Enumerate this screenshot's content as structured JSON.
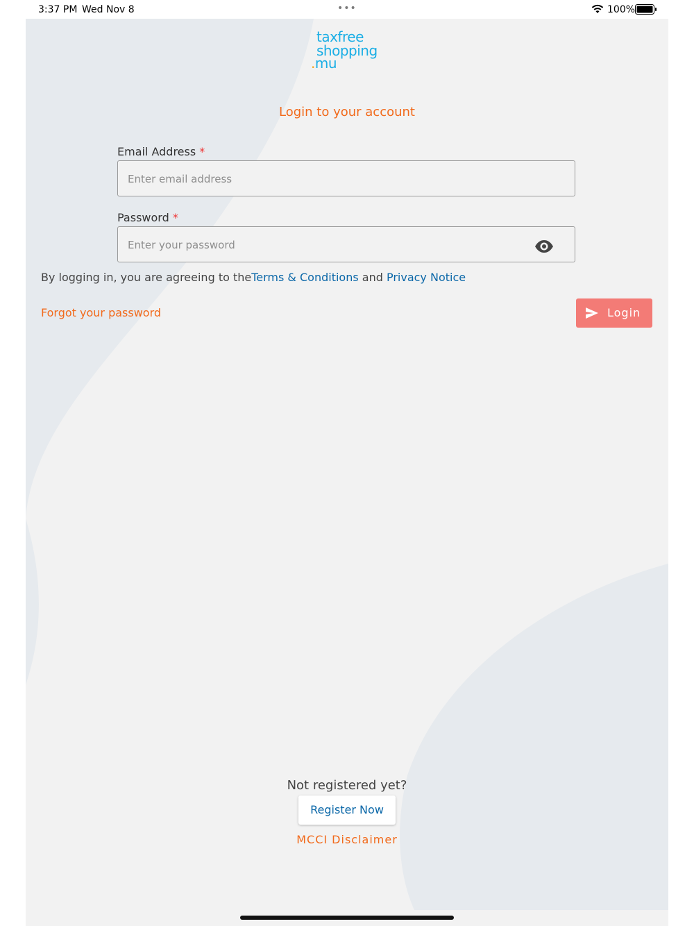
{
  "status_bar": {
    "time": "3:37 PM",
    "date": "Wed Nov 8",
    "dots": "•••",
    "battery_pct": "100%",
    "wifi_icon": "wifi-icon",
    "battery_icon": "battery-icon"
  },
  "logo": {
    "line1": "taxfree",
    "line2": "shopping",
    "line3_dot": ".",
    "line3": "mu"
  },
  "login_title": "Login to your account",
  "email": {
    "label": "Email Address",
    "required": "*",
    "placeholder": "Enter email address",
    "value": ""
  },
  "password": {
    "label": "Password",
    "required": "*",
    "placeholder": "Enter your password",
    "value": "",
    "toggle_icon": "eye-icon"
  },
  "terms": {
    "prefix": "By logging in, you are agreeing to the",
    "terms_link": "Terms & Conditions",
    "and": " and ",
    "privacy_link": "Privacy Notice"
  },
  "forgot_password": "Forgot your password",
  "login_button": {
    "label": "Login",
    "icon": "send-icon"
  },
  "not_registered": "Not registered yet?",
  "register_button": "Register Now",
  "disclaimer": "MCCI Disclaimer",
  "colors": {
    "accent_orange": "#f26a1b",
    "link_blue": "#0a67a8",
    "login_button_bg": "#f37b76",
    "logo_blue": "#1aaee5",
    "logo_dot": "#f4a622",
    "background": "#f2f2f2"
  }
}
